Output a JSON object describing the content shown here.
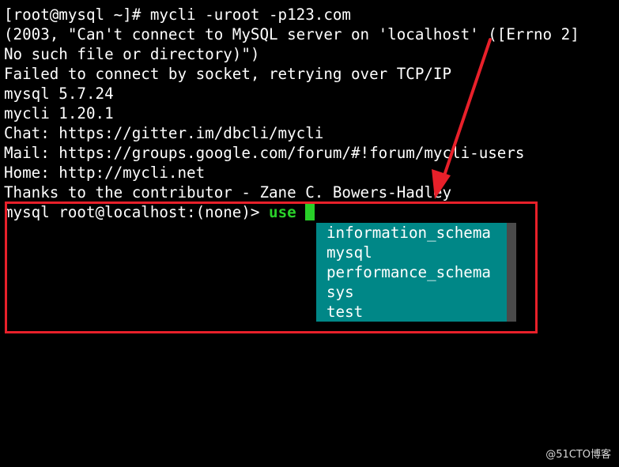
{
  "terminal": {
    "lines": [
      "[root@mysql ~]# mycli -uroot -p123.com",
      "(2003, \"Can't connect to MySQL server on 'localhost' ([Errno 2]",
      "No such file or directory)\")",
      "Failed to connect by socket, retrying over TCP/IP",
      "mysql 5.7.24",
      "mycli 1.20.1",
      "Chat: https://gitter.im/dbcli/mycli",
      "Mail: https://groups.google.com/forum/#!forum/mycli-users",
      "Home: http://mycli.net",
      "Thanks to the contributor - Zane C. Bowers-Hadley"
    ],
    "prompt": "mysql root@localhost:(none)> ",
    "command": "use "
  },
  "completion": {
    "items": [
      "information_schema",
      "mysql",
      "performance_schema",
      "sys",
      "test"
    ]
  },
  "colors": {
    "background": "#000000",
    "completion_bg": "#008787",
    "command_green": "#2ad12a",
    "highlight_red": "#e8202a"
  },
  "watermark": "@51CTO博客"
}
